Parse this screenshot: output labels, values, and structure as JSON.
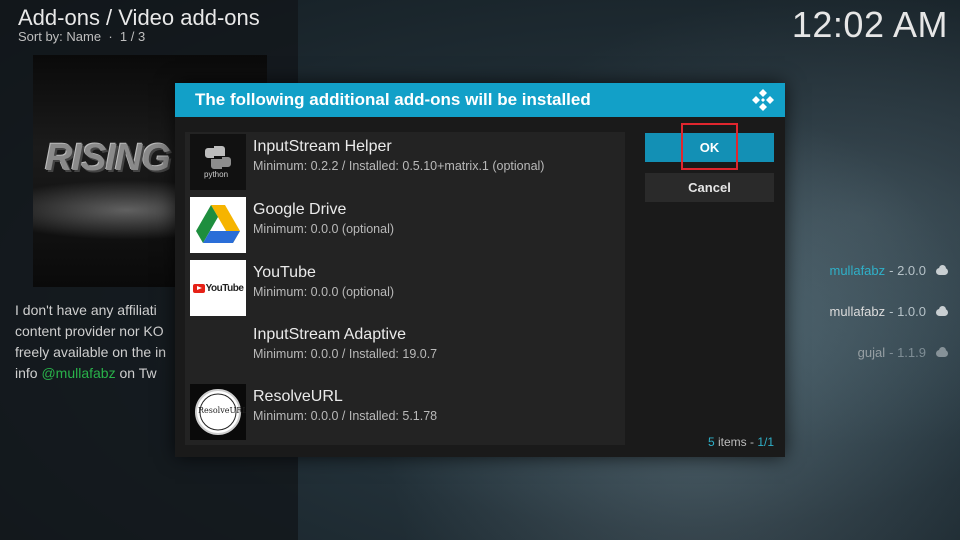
{
  "header": {
    "title": "Add-ons / Video add-ons",
    "sort": "Sort by: Name",
    "sep": "·",
    "page": "1 / 3",
    "clock": "12:02 AM"
  },
  "fanart": {
    "text": "RISING T"
  },
  "description": {
    "line1": "I don't have any affiliati",
    "line2": "content provider nor KO",
    "line3": "freely available on the in",
    "line4_pre": "info ",
    "line4_handle": "@mullafabz",
    "line4_post": " on Tw"
  },
  "right_list": [
    {
      "name": "mullafabz",
      "version": "- 2.0.0",
      "icon": "cloud-download-icon"
    },
    {
      "name": "mullafabz",
      "version": "- 1.0.0",
      "icon": "cloud-download-icon"
    },
    {
      "name": "gujal",
      "version": "- 1.1.9",
      "icon": "cloud-download-icon"
    }
  ],
  "dialog": {
    "title": "The following additional add-ons will be installed",
    "ok_label": "OK",
    "cancel_label": "Cancel",
    "count_number": "5",
    "count_items": "items - ",
    "count_page": "1/1",
    "items": [
      {
        "name": "InputStream Helper",
        "detail": "Minimum: 0.2.2 / Installed: 0.5.10+matrix.1 (optional)",
        "thumb_label": "python"
      },
      {
        "name": "Google Drive",
        "detail": "Minimum: 0.0.0 (optional)"
      },
      {
        "name": "YouTube",
        "detail": "Minimum: 0.0.0 (optional)",
        "thumb_label": "YouTube"
      },
      {
        "name": "InputStream Adaptive",
        "detail": "Minimum: 0.0.0 / Installed: 19.0.7"
      },
      {
        "name": "ResolveURL",
        "detail": "Minimum: 0.0.0 / Installed: 5.1.78",
        "thumb_label": "ResolveURL"
      }
    ]
  },
  "colors": {
    "accent": "#12a0c8",
    "ok_button": "#1390b5",
    "highlight_border": "#e0262e",
    "handle_green": "#29b24a"
  }
}
